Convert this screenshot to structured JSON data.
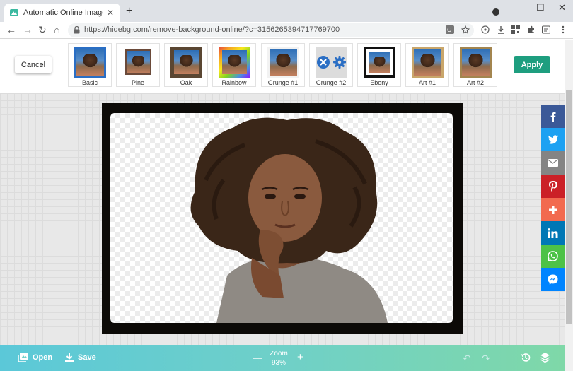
{
  "browser": {
    "tab_title": "Automatic Online Image Backg",
    "url": "https://hidebg.com/remove-background-online/?c=3156265394717769700",
    "new_tab_icon": "plus-icon",
    "minimize": "—",
    "maximize": "☐",
    "close": "✕"
  },
  "frames_bar": {
    "cancel_label": "Cancel",
    "apply_label": "Apply",
    "frames": [
      {
        "label": "Basic",
        "border": "#2a6ec4",
        "selected": true
      },
      {
        "label": "Pine",
        "border": "#ffffff"
      },
      {
        "label": "Oak",
        "border": "#5a4632"
      },
      {
        "label": "Rainbow",
        "border": "rainbow"
      },
      {
        "label": "Grunge #1",
        "border": "#f2f2f2"
      },
      {
        "label": "Grunge #2",
        "border": "#dcdcdc"
      },
      {
        "label": "Ebony",
        "border": "#111111"
      },
      {
        "label": "Art #1",
        "border": "#c9a66b"
      },
      {
        "label": "Art #2",
        "border": "#a3854f"
      }
    ]
  },
  "share": [
    {
      "name": "facebook",
      "color": "#3b5998",
      "glyph": "f"
    },
    {
      "name": "twitter",
      "color": "#1da1f2",
      "glyph": "t"
    },
    {
      "name": "email",
      "color": "#848484",
      "glyph": "✉"
    },
    {
      "name": "pinterest",
      "color": "#cb2027",
      "glyph": "P"
    },
    {
      "name": "more",
      "color": "#f26a4f",
      "glyph": "+"
    },
    {
      "name": "linkedin",
      "color": "#0077b5",
      "glyph": "in"
    },
    {
      "name": "whatsapp",
      "color": "#4dc247",
      "glyph": "✆"
    },
    {
      "name": "messenger",
      "color": "#0084ff",
      "glyph": "~"
    }
  ],
  "bottom_bar": {
    "open_label": "Open",
    "save_label": "Save",
    "zoom_label": "Zoom",
    "zoom_value": "93%"
  }
}
